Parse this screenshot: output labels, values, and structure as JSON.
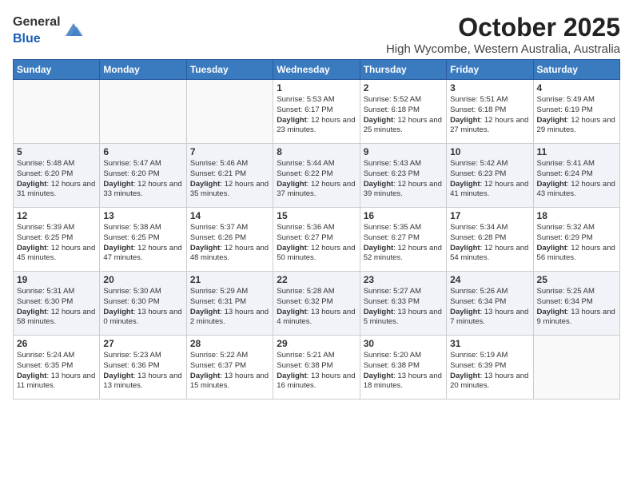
{
  "logo": {
    "general": "General",
    "blue": "Blue"
  },
  "title": "October 2025",
  "subtitle": "High Wycombe, Western Australia, Australia",
  "days_of_week": [
    "Sunday",
    "Monday",
    "Tuesday",
    "Wednesday",
    "Thursday",
    "Friday",
    "Saturday"
  ],
  "weeks": [
    [
      {
        "day": "",
        "info": ""
      },
      {
        "day": "",
        "info": ""
      },
      {
        "day": "",
        "info": ""
      },
      {
        "day": "1",
        "info": "Sunrise: 5:53 AM\nSunset: 6:17 PM\nDaylight: 12 hours and 23 minutes."
      },
      {
        "day": "2",
        "info": "Sunrise: 5:52 AM\nSunset: 6:18 PM\nDaylight: 12 hours and 25 minutes."
      },
      {
        "day": "3",
        "info": "Sunrise: 5:51 AM\nSunset: 6:18 PM\nDaylight: 12 hours and 27 minutes."
      },
      {
        "day": "4",
        "info": "Sunrise: 5:49 AM\nSunset: 6:19 PM\nDaylight: 12 hours and 29 minutes."
      }
    ],
    [
      {
        "day": "5",
        "info": "Sunrise: 5:48 AM\nSunset: 6:20 PM\nDaylight: 12 hours and 31 minutes."
      },
      {
        "day": "6",
        "info": "Sunrise: 5:47 AM\nSunset: 6:20 PM\nDaylight: 12 hours and 33 minutes."
      },
      {
        "day": "7",
        "info": "Sunrise: 5:46 AM\nSunset: 6:21 PM\nDaylight: 12 hours and 35 minutes."
      },
      {
        "day": "8",
        "info": "Sunrise: 5:44 AM\nSunset: 6:22 PM\nDaylight: 12 hours and 37 minutes."
      },
      {
        "day": "9",
        "info": "Sunrise: 5:43 AM\nSunset: 6:23 PM\nDaylight: 12 hours and 39 minutes."
      },
      {
        "day": "10",
        "info": "Sunrise: 5:42 AM\nSunset: 6:23 PM\nDaylight: 12 hours and 41 minutes."
      },
      {
        "day": "11",
        "info": "Sunrise: 5:41 AM\nSunset: 6:24 PM\nDaylight: 12 hours and 43 minutes."
      }
    ],
    [
      {
        "day": "12",
        "info": "Sunrise: 5:39 AM\nSunset: 6:25 PM\nDaylight: 12 hours and 45 minutes."
      },
      {
        "day": "13",
        "info": "Sunrise: 5:38 AM\nSunset: 6:25 PM\nDaylight: 12 hours and 47 minutes."
      },
      {
        "day": "14",
        "info": "Sunrise: 5:37 AM\nSunset: 6:26 PM\nDaylight: 12 hours and 48 minutes."
      },
      {
        "day": "15",
        "info": "Sunrise: 5:36 AM\nSunset: 6:27 PM\nDaylight: 12 hours and 50 minutes."
      },
      {
        "day": "16",
        "info": "Sunrise: 5:35 AM\nSunset: 6:27 PM\nDaylight: 12 hours and 52 minutes."
      },
      {
        "day": "17",
        "info": "Sunrise: 5:34 AM\nSunset: 6:28 PM\nDaylight: 12 hours and 54 minutes."
      },
      {
        "day": "18",
        "info": "Sunrise: 5:32 AM\nSunset: 6:29 PM\nDaylight: 12 hours and 56 minutes."
      }
    ],
    [
      {
        "day": "19",
        "info": "Sunrise: 5:31 AM\nSunset: 6:30 PM\nDaylight: 12 hours and 58 minutes."
      },
      {
        "day": "20",
        "info": "Sunrise: 5:30 AM\nSunset: 6:30 PM\nDaylight: 13 hours and 0 minutes."
      },
      {
        "day": "21",
        "info": "Sunrise: 5:29 AM\nSunset: 6:31 PM\nDaylight: 13 hours and 2 minutes."
      },
      {
        "day": "22",
        "info": "Sunrise: 5:28 AM\nSunset: 6:32 PM\nDaylight: 13 hours and 4 minutes."
      },
      {
        "day": "23",
        "info": "Sunrise: 5:27 AM\nSunset: 6:33 PM\nDaylight: 13 hours and 5 minutes."
      },
      {
        "day": "24",
        "info": "Sunrise: 5:26 AM\nSunset: 6:34 PM\nDaylight: 13 hours and 7 minutes."
      },
      {
        "day": "25",
        "info": "Sunrise: 5:25 AM\nSunset: 6:34 PM\nDaylight: 13 hours and 9 minutes."
      }
    ],
    [
      {
        "day": "26",
        "info": "Sunrise: 5:24 AM\nSunset: 6:35 PM\nDaylight: 13 hours and 11 minutes."
      },
      {
        "day": "27",
        "info": "Sunrise: 5:23 AM\nSunset: 6:36 PM\nDaylight: 13 hours and 13 minutes."
      },
      {
        "day": "28",
        "info": "Sunrise: 5:22 AM\nSunset: 6:37 PM\nDaylight: 13 hours and 15 minutes."
      },
      {
        "day": "29",
        "info": "Sunrise: 5:21 AM\nSunset: 6:38 PM\nDaylight: 13 hours and 16 minutes."
      },
      {
        "day": "30",
        "info": "Sunrise: 5:20 AM\nSunset: 6:38 PM\nDaylight: 13 hours and 18 minutes."
      },
      {
        "day": "31",
        "info": "Sunrise: 5:19 AM\nSunset: 6:39 PM\nDaylight: 13 hours and 20 minutes."
      },
      {
        "day": "",
        "info": ""
      }
    ]
  ]
}
